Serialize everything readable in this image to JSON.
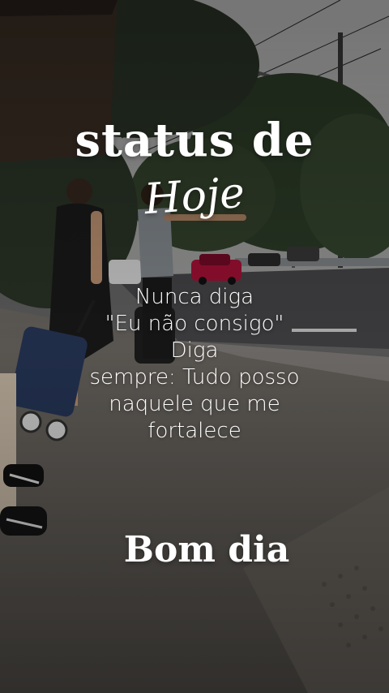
{
  "title": {
    "line1": "status de",
    "line2": "Hoje"
  },
  "message": {
    "lines": [
      "Nunca diga",
      "\"Eu não consigo\"",
      "Diga",
      "sempre: Tudo posso",
      "naquele que me",
      "fortalece"
    ]
  },
  "footer": {
    "greeting": "Bom dia"
  },
  "colors": {
    "text": "#ffffff",
    "sky": "#bdbdbd",
    "road": "#4a4a4a",
    "sidewalk": "#7a756f",
    "car": "#b0123a"
  }
}
